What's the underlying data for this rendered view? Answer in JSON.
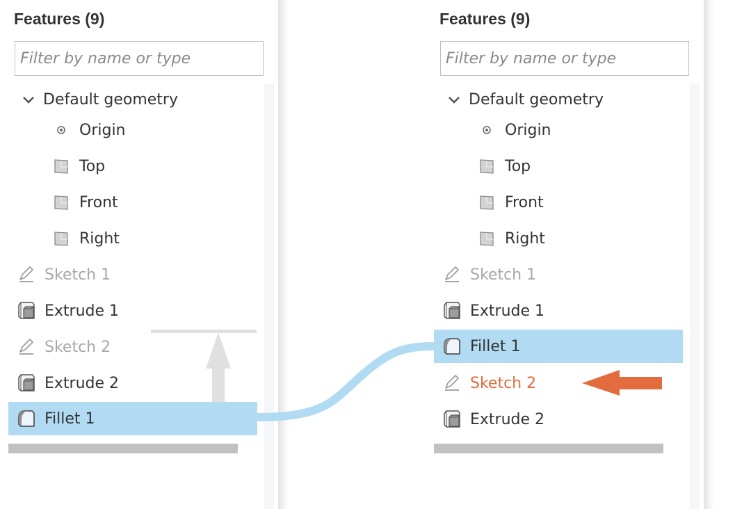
{
  "left_panel": {
    "title": "Features (9)",
    "filter_placeholder": "Filter by name or type",
    "group": {
      "label": "Default geometry",
      "expanded": true,
      "items": [
        {
          "label": "Origin",
          "icon": "origin-point-icon"
        },
        {
          "label": "Top",
          "icon": "plane-icon"
        },
        {
          "label": "Front",
          "icon": "plane-icon"
        },
        {
          "label": "Right",
          "icon": "plane-icon"
        }
      ]
    },
    "features": [
      {
        "label": "Sketch 1",
        "icon": "sketch-pencil-icon",
        "state": "dim"
      },
      {
        "label": "Extrude 1",
        "icon": "extrude-icon",
        "state": "normal"
      },
      {
        "label": "Sketch 2",
        "icon": "sketch-pencil-icon",
        "state": "dim"
      },
      {
        "label": "Extrude 2",
        "icon": "extrude-icon",
        "state": "normal"
      },
      {
        "label": "Fillet 1",
        "icon": "fillet-icon",
        "state": "selected"
      }
    ]
  },
  "right_panel": {
    "title": "Features (9)",
    "filter_placeholder": "Filter by name or type",
    "group": {
      "label": "Default geometry",
      "expanded": true,
      "items": [
        {
          "label": "Origin",
          "icon": "origin-point-icon"
        },
        {
          "label": "Top",
          "icon": "plane-icon"
        },
        {
          "label": "Front",
          "icon": "plane-icon"
        },
        {
          "label": "Right",
          "icon": "plane-icon"
        }
      ]
    },
    "features": [
      {
        "label": "Sketch 1",
        "icon": "sketch-pencil-icon",
        "state": "dim"
      },
      {
        "label": "Extrude 1",
        "icon": "extrude-icon",
        "state": "normal"
      },
      {
        "label": "Fillet 1",
        "icon": "fillet-icon",
        "state": "selected"
      },
      {
        "label": "Sketch 2",
        "icon": "sketch-pencil-icon",
        "state": "highlighted"
      },
      {
        "label": "Extrude 2",
        "icon": "extrude-icon",
        "state": "normal"
      }
    ]
  },
  "colors": {
    "selection": "#b0dbf3",
    "highlight_orange": "#e36c3f",
    "drag_arrow_gray": "#e0e0e0",
    "rollback_bar": "#c1c1c1"
  }
}
